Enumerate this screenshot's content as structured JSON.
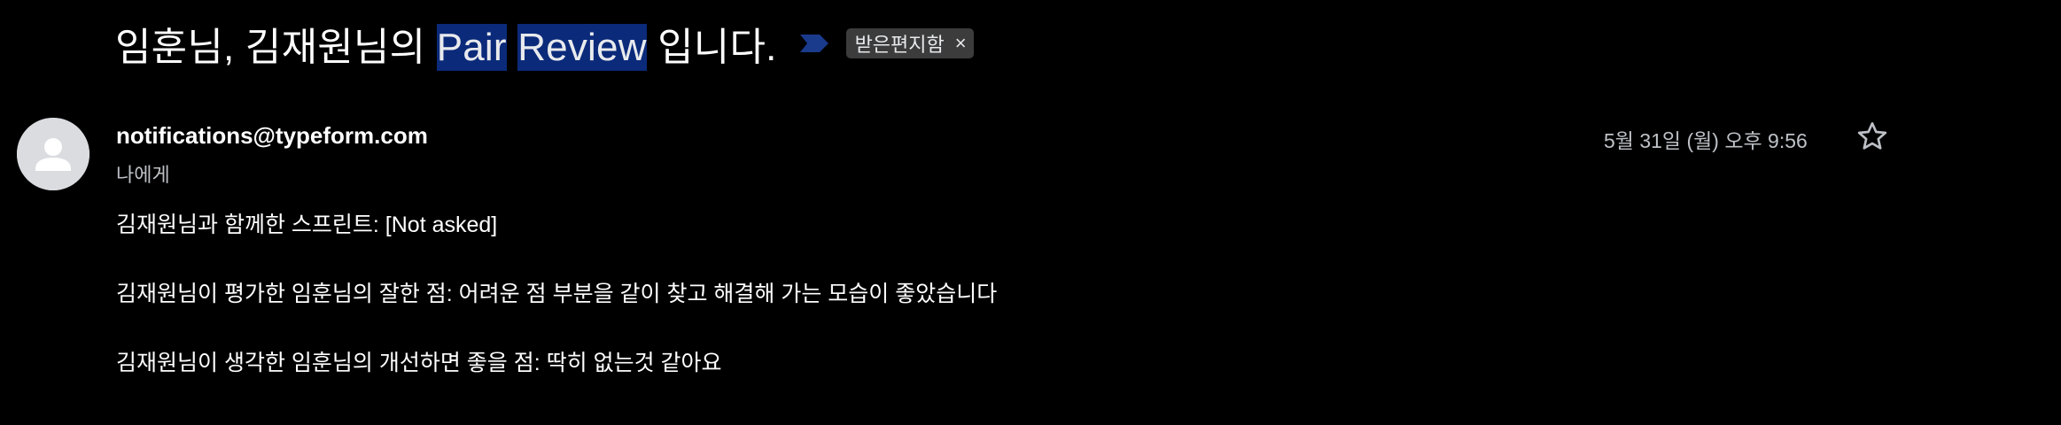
{
  "email": {
    "subject": {
      "prefix": "임훈님, 김재원님의 ",
      "highlight1": "Pair",
      "space": " ",
      "highlight2": "Review",
      "suffix": " 입니다."
    },
    "important_icon": "important-marker-icon",
    "label_chip": {
      "text": "받은편지함",
      "close": "×"
    },
    "sender": {
      "avatar_icon": "person-icon",
      "email": "notifications@typeform.com",
      "to": "나에게"
    },
    "date": "5월 31일 (월) 오후 9:56",
    "star_icon": "star-outline-icon",
    "body": [
      "김재원님과 함께한 스프린트: [Not asked]",
      "김재원님이 평가한 임훈님의 잘한 점: 어려운 점 부분을 같이 찾고 해결해 가는 모습이 좋았습니다",
      "김재원님이 생각한 임훈님의 개선하면 좋을 점: 딱히 없는것 같아요"
    ]
  },
  "colors": {
    "background": "#000000",
    "highlight": "#0b2a7a",
    "important_marker": "#1a3a8c",
    "chip_bg": "#3c3c3c",
    "avatar_bg": "#dadce0"
  }
}
